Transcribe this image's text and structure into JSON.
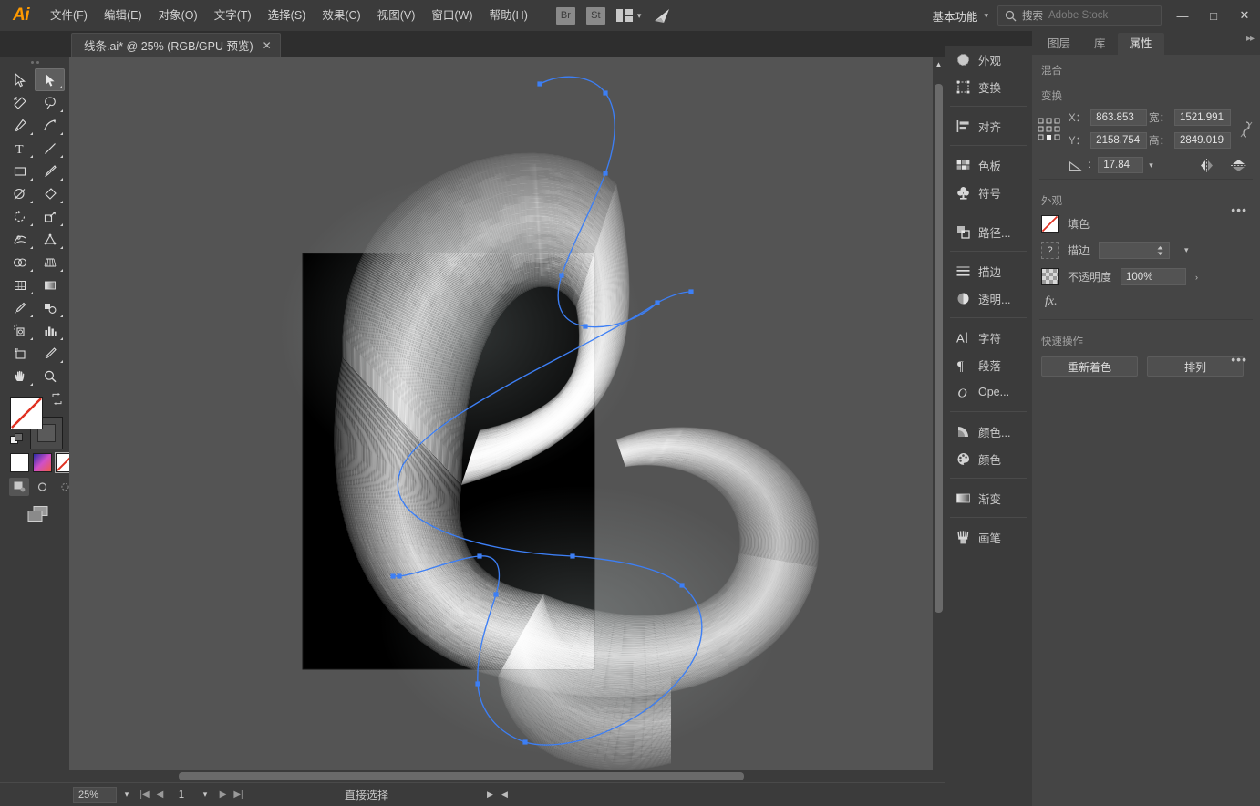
{
  "app": {
    "logo": "Ai"
  },
  "menubar": {
    "items": [
      {
        "label": "文件(F)"
      },
      {
        "label": "编辑(E)"
      },
      {
        "label": "对象(O)"
      },
      {
        "label": "文字(T)"
      },
      {
        "label": "选择(S)"
      },
      {
        "label": "效果(C)"
      },
      {
        "label": "视图(V)"
      },
      {
        "label": "窗口(W)"
      },
      {
        "label": "帮助(H)"
      }
    ],
    "bridge_label": "Br",
    "stock_label": "St",
    "workspace": "基本功能",
    "search_query": "搜索",
    "search_placeholder": "Adobe Stock",
    "minimize": "—",
    "maximize": "□",
    "close": "✕"
  },
  "tabbar": {
    "document": "线条.ai* @ 25% (RGB/GPU 预览)",
    "close_glyph": "✕",
    "collapse_glyph": "◀◀"
  },
  "statusbar": {
    "zoom": "25%",
    "page": "1",
    "tool": "直接选择",
    "prev_glyph": "◀",
    "next_glyph": "▶"
  },
  "dock": {
    "groups": [
      {
        "items": [
          {
            "label": "外观",
            "icon": "appearance-icon"
          },
          {
            "label": "变换",
            "icon": "transform-icon"
          }
        ]
      },
      {
        "items": [
          {
            "label": "对齐",
            "icon": "align-icon"
          }
        ]
      },
      {
        "items": [
          {
            "label": "色板",
            "icon": "swatches-icon"
          },
          {
            "label": "符号",
            "icon": "symbols-icon"
          }
        ]
      },
      {
        "items": [
          {
            "label": "路径...",
            "icon": "pathfinder-icon"
          }
        ]
      },
      {
        "items": [
          {
            "label": "描边",
            "icon": "stroke-icon"
          },
          {
            "label": "透明...",
            "icon": "transparency-icon"
          }
        ]
      },
      {
        "items": [
          {
            "label": "字符",
            "icon": "character-icon"
          },
          {
            "label": "段落",
            "icon": "paragraph-icon"
          },
          {
            "label": "Ope...",
            "icon": "opentype-icon"
          }
        ]
      },
      {
        "items": [
          {
            "label": "颜色...",
            "icon": "color-guide-icon"
          },
          {
            "label": "颜色",
            "icon": "color-icon"
          }
        ]
      },
      {
        "items": [
          {
            "label": "渐变",
            "icon": "gradient-icon"
          }
        ]
      },
      {
        "items": [
          {
            "label": "画笔",
            "icon": "brushes-icon"
          }
        ]
      }
    ]
  },
  "properties": {
    "tabs": [
      {
        "label": "图层",
        "active": false
      },
      {
        "label": "库",
        "active": false
      },
      {
        "label": "属性",
        "active": true
      }
    ],
    "blend_title": "混合",
    "transform": {
      "title": "变换",
      "x_label": "X：",
      "x_value": "863.853",
      "y_label": "Y：",
      "y_value": "2158.754",
      "w_label": "宽：",
      "w_value": "1521.991",
      "h_label": "高：",
      "h_value": "2849.019",
      "angle_label": "∠:",
      "angle_value": "17.84",
      "more_glyph": "•••"
    },
    "appearance": {
      "title": "外观",
      "fill_label": "填色",
      "fill_value": "无",
      "stroke_label": "描边",
      "stroke_value": "",
      "opacity_label": "不透明度",
      "opacity_value": "100%",
      "fx_label": "fx.",
      "more_glyph": "•••"
    },
    "quick_actions": {
      "title": "快速操作",
      "buttons": [
        {
          "label": "重新着色"
        },
        {
          "label": "排列"
        }
      ]
    }
  },
  "toolbar": {
    "tools": [
      {
        "name": "selection-tool",
        "active": false
      },
      {
        "name": "direct-selection-tool",
        "active": true
      },
      {
        "name": "magic-wand-tool",
        "active": false
      },
      {
        "name": "lasso-tool",
        "active": false
      },
      {
        "name": "pen-tool",
        "active": false
      },
      {
        "name": "curvature-tool",
        "active": false
      },
      {
        "name": "type-tool",
        "active": false
      },
      {
        "name": "line-segment-tool",
        "active": false
      },
      {
        "name": "rectangle-tool",
        "active": false
      },
      {
        "name": "paintbrush-tool",
        "active": false
      },
      {
        "name": "shaper-tool",
        "active": false
      },
      {
        "name": "eraser-tool",
        "active": false
      },
      {
        "name": "rotate-tool",
        "active": false
      },
      {
        "name": "scale-tool",
        "active": false
      },
      {
        "name": "width-tool",
        "active": false
      },
      {
        "name": "free-transform-tool",
        "active": false
      },
      {
        "name": "shape-builder-tool",
        "active": false
      },
      {
        "name": "perspective-grid-tool",
        "active": false
      },
      {
        "name": "mesh-tool",
        "active": false
      },
      {
        "name": "gradient-tool",
        "active": false
      },
      {
        "name": "eyedropper-tool",
        "active": false
      },
      {
        "name": "blend-tool",
        "active": false
      },
      {
        "name": "symbol-sprayer-tool",
        "active": false
      },
      {
        "name": "column-graph-tool",
        "active": false
      },
      {
        "name": "artboard-tool",
        "active": false
      },
      {
        "name": "slice-tool",
        "active": false
      },
      {
        "name": "hand-tool",
        "active": false
      },
      {
        "name": "zoom-tool",
        "active": false
      }
    ],
    "fill_label": "填色",
    "stroke_label": "描边"
  },
  "colors": {
    "accent_blue": "#3d7ff5",
    "panel_bg": "#454545",
    "chrome_bg": "#3b3b3b",
    "canvas_bg": "#545454",
    "artboard_bg": "#000000",
    "logo_orange": "#ff9a00",
    "none_red": "#e03020"
  }
}
